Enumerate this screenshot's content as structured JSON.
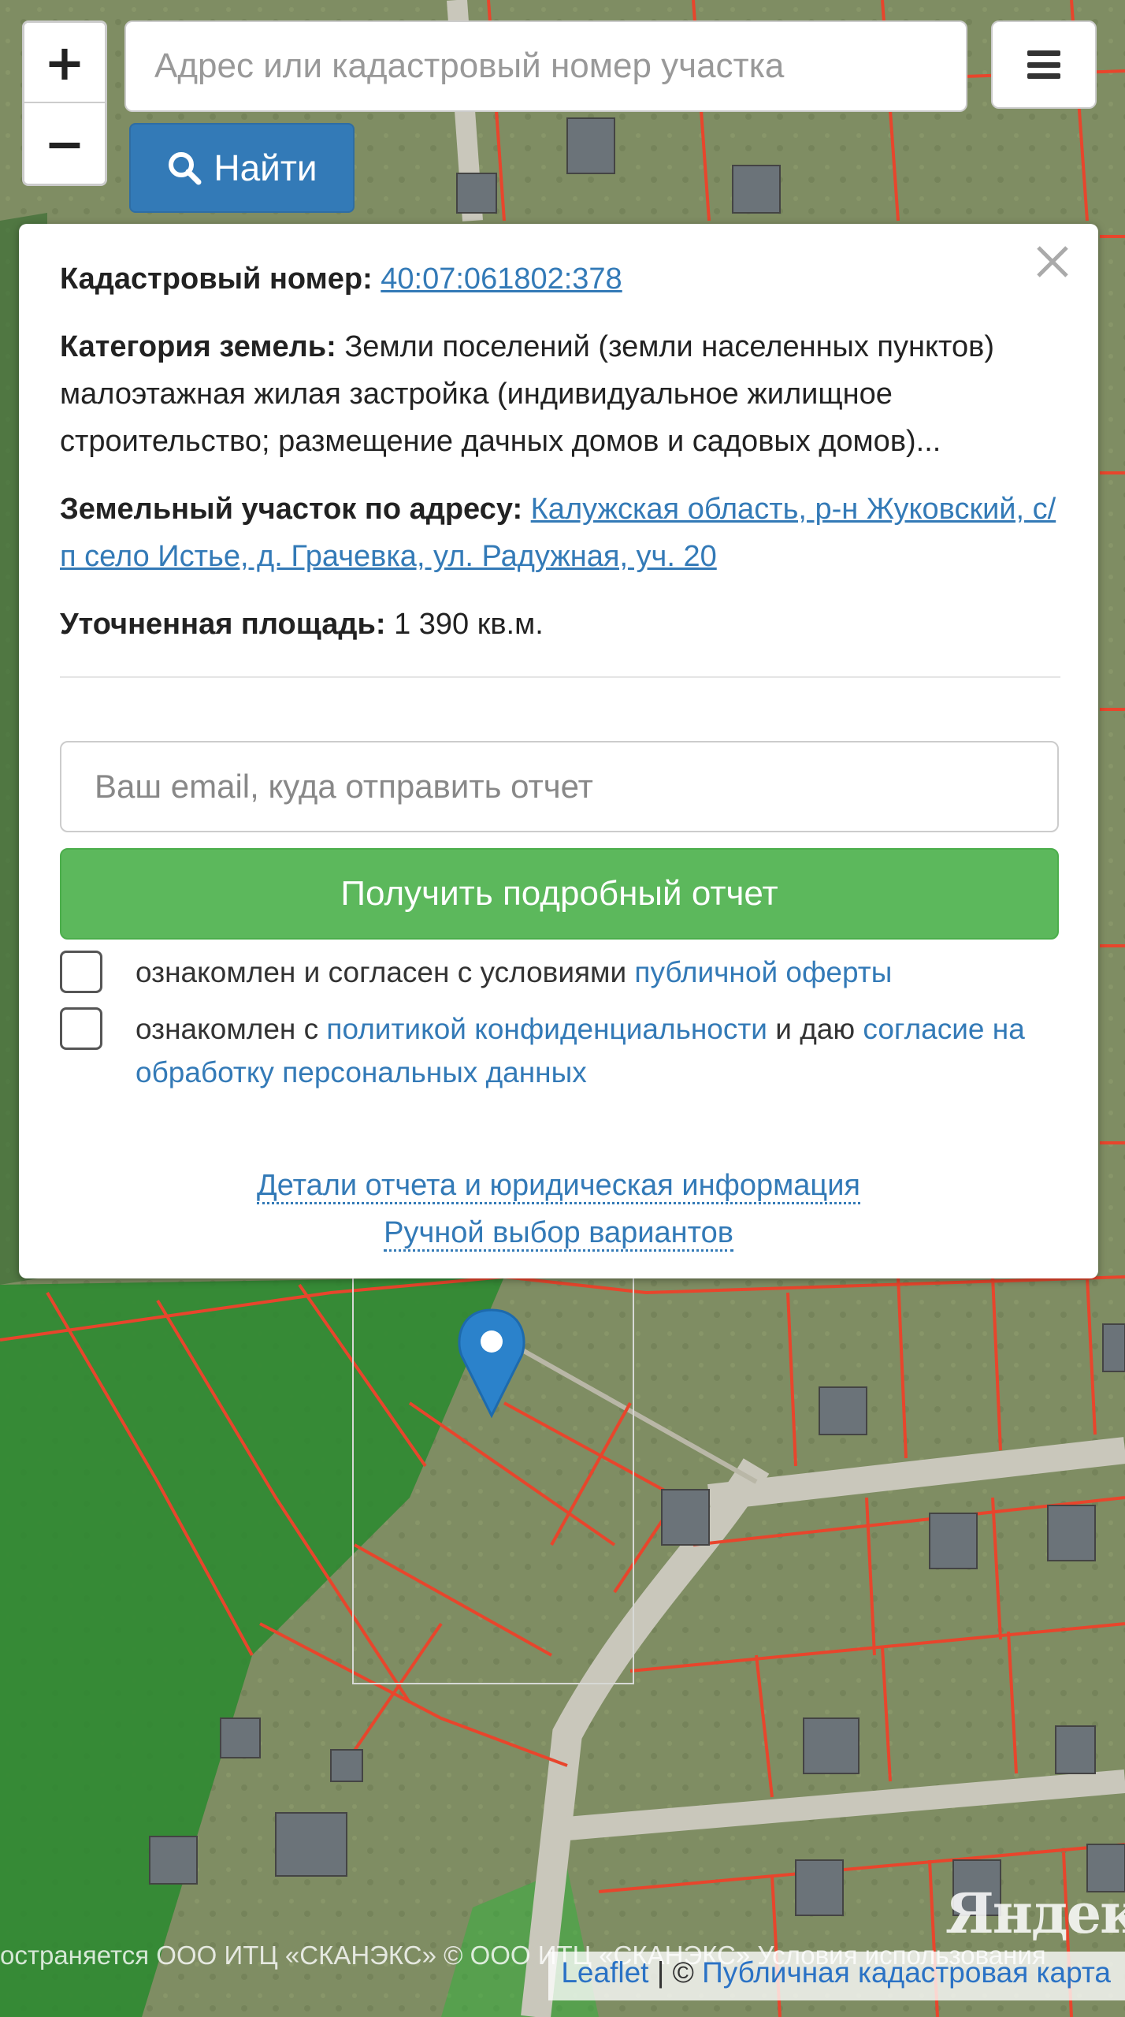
{
  "zoom": {
    "in_label": "+",
    "out_label": "−"
  },
  "search": {
    "placeholder": "Адрес или кадастровый номер участка",
    "button_label": "Найти"
  },
  "popup": {
    "cadastral_label": "Кадастровый номер:",
    "cadastral_number": "40:07:061802:378",
    "category_label": "Категория земель:",
    "category_value": "Земли поселений (земли населенных пунктов)",
    "usage_text": "малоэтажная жилая застройка (индивидуальное жилищное строительство; размещение дачных домов и садовых домов)...",
    "address_label": "Земельный участок по адресу:",
    "address_link": "Калужская область, р-н Жуковский, с/п село Истье, д. Грачевка, ул. Радужная, уч. 20",
    "area_label": "Уточненная площадь:",
    "area_value": "1 390 кв.м.",
    "email_placeholder": "Ваш email, куда отправить отчет",
    "report_button": "Получить подробный отчет",
    "consent1": {
      "prefix": "ознакомлен и согласен с условиями",
      "link": "публичной оферты"
    },
    "consent2": {
      "prefix": "ознакомлен с",
      "link1": "политикой конфиденциальности",
      "middle": "и даю",
      "link2": "согласие на обработку персональных данных"
    },
    "details_link": "Детали отчета и юридическая информация",
    "manual_link": "Ручной выбор вариантов"
  },
  "attribution": {
    "faded": "остраняется ООО ИТЦ «СКАНЭКС» © ООО ИТЦ «СКАНЭКС» Условия использования",
    "leaflet": "Leaflet",
    "separator": "| ©",
    "cadastral_map": "Публичная кадастровая карта",
    "yandex": "Яндекс"
  },
  "colors": {
    "primary": "#337ab7",
    "success": "#5cb85c",
    "parcel_border": "#e8452c",
    "forest_zone": "#2fb43a",
    "marker": "#2b82cb"
  },
  "icons": {
    "search": "search-icon",
    "menu": "menu-icon",
    "close": "close-icon",
    "marker": "map-marker-icon"
  }
}
